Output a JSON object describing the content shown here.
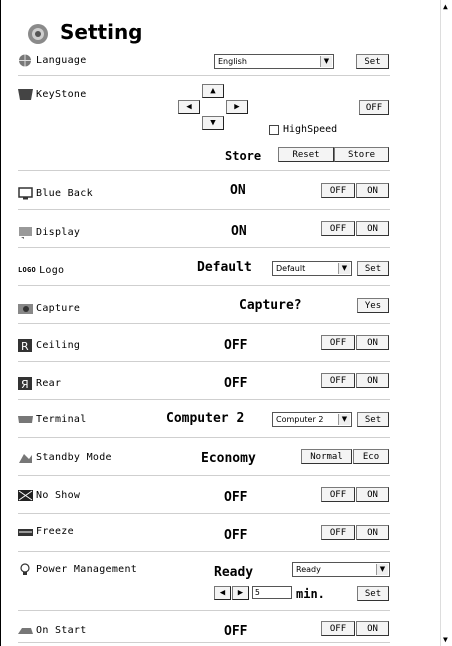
{
  "title": "Setting",
  "language": {
    "label": "Language",
    "select": "English",
    "set": "Set"
  },
  "keystone": {
    "label": "KeyStone",
    "off": "OFF",
    "highspeed": "HighSpeed",
    "store_label": "Store",
    "reset": "Reset",
    "store": "Store"
  },
  "blue_back": {
    "label": "Blue Back",
    "value": "ON",
    "off": "OFF",
    "on": "ON"
  },
  "display": {
    "label": "Display",
    "value": "ON",
    "off": "OFF",
    "on": "ON"
  },
  "logo": {
    "label": "Logo",
    "icon_text": "LOGO",
    "value": "Default",
    "select": "Default",
    "set": "Set"
  },
  "capture": {
    "label": "Capture",
    "value": "Capture?",
    "yes": "Yes"
  },
  "ceiling": {
    "label": "Ceiling",
    "value": "OFF",
    "off": "OFF",
    "on": "ON"
  },
  "rear": {
    "label": "Rear",
    "value": "OFF",
    "off": "OFF",
    "on": "ON"
  },
  "terminal": {
    "label": "Terminal",
    "value": "Computer 2",
    "select": "Computer 2",
    "set": "Set"
  },
  "standby": {
    "label": "Standby Mode",
    "value": "Economy",
    "normal": "Normal",
    "eco": "Eco"
  },
  "no_show": {
    "label": "No Show",
    "value": "OFF",
    "off": "OFF",
    "on": "ON"
  },
  "freeze": {
    "label": "Freeze",
    "value": "OFF",
    "off": "OFF",
    "on": "ON"
  },
  "power": {
    "label": "Power Management",
    "value": "Ready",
    "select": "Ready",
    "minutes": "5",
    "min_label": "min.",
    "set": "Set"
  },
  "on_start": {
    "label": "On Start",
    "value": "OFF",
    "off": "OFF",
    "on": "ON"
  }
}
